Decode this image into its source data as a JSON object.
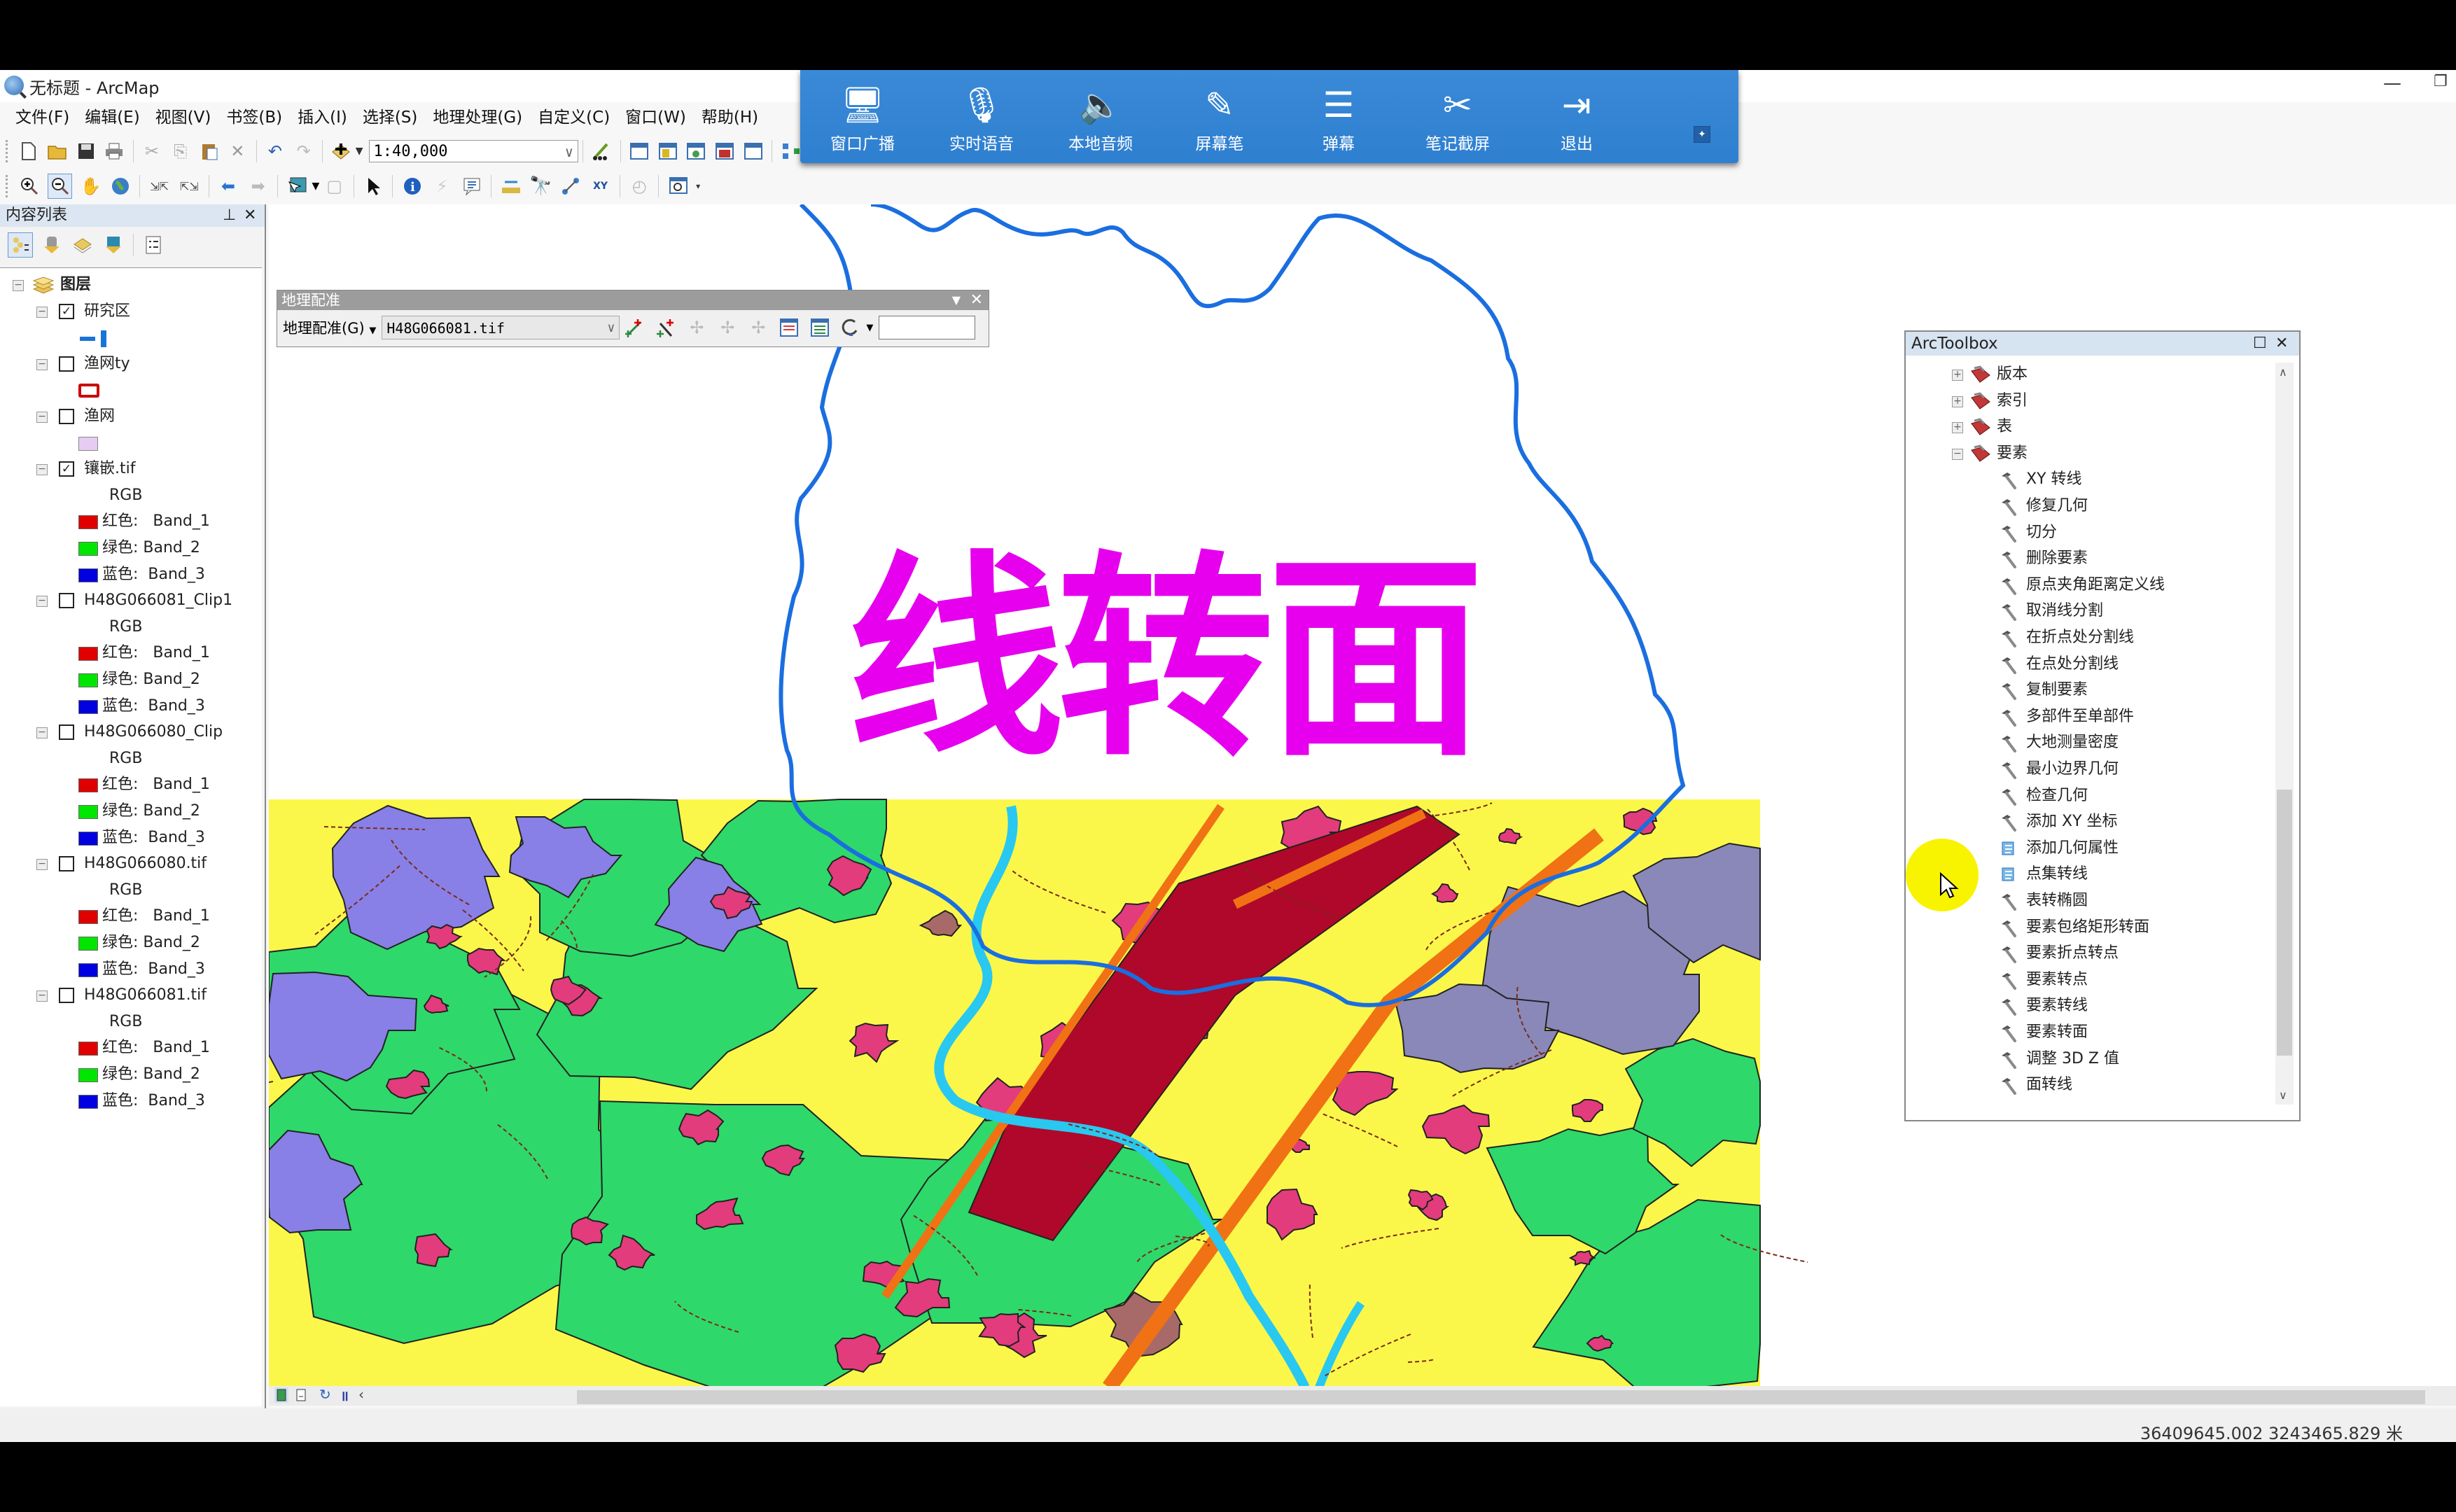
{
  "window": {
    "title": "无标题 - ArcMap",
    "minimize_icon": "minimize-icon",
    "restore_icon": "restore-icon"
  },
  "menu": [
    "文件(F)",
    "编辑(E)",
    "视图(V)",
    "书签(B)",
    "插入(I)",
    "选择(S)",
    "地理处理(G)",
    "自定义(C)",
    "窗口(W)",
    "帮助(H)"
  ],
  "standard_toolbar": {
    "icons": [
      "new-document-icon",
      "open-folder-icon",
      "save-icon",
      "print-icon",
      "cut-icon",
      "copy-icon",
      "paste-icon",
      "delete-icon",
      "undo-icon",
      "redo-icon",
      "add-data-icon"
    ],
    "scale": "1:40,000",
    "right_icons": [
      "editor-toolbar-icon",
      "toc-window-icon",
      "catalog-window-icon",
      "search-window-icon",
      "arctoolbox-icon",
      "python-window-icon",
      "modelbuilder-icon"
    ]
  },
  "tools_toolbar": {
    "icons": [
      "zoom-in-icon",
      "zoom-out-icon",
      "pan-icon",
      "full-extent-icon",
      "fixed-zoom-in-icon",
      "fixed-zoom-out-icon",
      "back-extent-icon",
      "forward-extent-icon",
      "select-features-icon",
      "clear-selection-icon",
      "select-elements-icon",
      "identify-icon",
      "hyperlink-icon",
      "html-popup-icon",
      "measure-icon",
      "find-icon",
      "find-route-icon",
      "go-to-xy-icon",
      "time-slider-icon",
      "magnifier-icon"
    ]
  },
  "overlay_toolbar": {
    "items": [
      {
        "label": "窗口广播",
        "icon": "screen-broadcast-icon"
      },
      {
        "label": "实时语音",
        "icon": "microphone-icon"
      },
      {
        "label": "本地音频",
        "icon": "local-audio-icon"
      },
      {
        "label": "屏幕笔",
        "icon": "screen-pen-icon"
      },
      {
        "label": "弹幕",
        "icon": "bullet-comment-icon"
      },
      {
        "label": "笔记截屏",
        "icon": "scissors-icon"
      },
      {
        "label": "退出",
        "icon": "exit-icon"
      }
    ],
    "accent": "#3386d6"
  },
  "toc": {
    "title": "内容列表",
    "root": "图层",
    "layers": [
      {
        "name": "研究区",
        "checked": true,
        "legend": {
          "type": "line",
          "color": "#1a73d8"
        }
      },
      {
        "name": "渔网ty",
        "checked": false,
        "legend": {
          "type": "outline",
          "color": "#cc0000"
        }
      },
      {
        "name": "渔网",
        "checked": false,
        "legend": {
          "type": "fill",
          "color": "#e6ccf2"
        }
      },
      {
        "name": "镶嵌.tif",
        "checked": true,
        "legend": {
          "type": "rgb"
        }
      },
      {
        "name": "H48G066081_Clip1",
        "checked": false,
        "legend": {
          "type": "rgb"
        }
      },
      {
        "name": "H48G066080_Clip",
        "checked": false,
        "legend": {
          "type": "rgb"
        }
      },
      {
        "name": "H48G066080.tif",
        "checked": false,
        "legend": {
          "type": "rgb"
        }
      },
      {
        "name": "H48G066081.tif",
        "checked": false,
        "legend": {
          "type": "rgb"
        }
      }
    ],
    "rgb_label": "RGB",
    "bands": [
      {
        "label": "红色:   Band_1",
        "color": "#e00000"
      },
      {
        "label": "绿色: Band_2",
        "color": "#00e600"
      },
      {
        "label": "蓝色:  Band_3",
        "color": "#0000e0"
      }
    ]
  },
  "georef_toolbar": {
    "title": "地理配准",
    "menu_label": "地理配准(G)",
    "layer": "H48G066081.tif",
    "icons": [
      "add-control-points-icon",
      "auto-adjust-icon",
      "select-link-icon",
      "zoom-to-selected-link-icon",
      "delete-link-icon",
      "view-link-table-icon",
      "view-link-table-2-icon",
      "rotate-icon"
    ]
  },
  "overlay_title": "线转面",
  "overlay_title_color": "#e600ee",
  "arctoolbox": {
    "title": "ArcToolbox",
    "toolsets": [
      {
        "label": "版本",
        "expanded": false
      },
      {
        "label": "索引",
        "expanded": false
      },
      {
        "label": "表",
        "expanded": false
      },
      {
        "label": "要素",
        "expanded": true
      }
    ],
    "tools": [
      {
        "label": "XY 转线",
        "icon": "hammer-icon"
      },
      {
        "label": "修复几何",
        "icon": "hammer-icon"
      },
      {
        "label": "切分",
        "icon": "hammer-icon"
      },
      {
        "label": "删除要素",
        "icon": "hammer-icon"
      },
      {
        "label": "原点夹角距离定义线",
        "icon": "hammer-icon"
      },
      {
        "label": "取消线分割",
        "icon": "hammer-icon"
      },
      {
        "label": "在折点处分割线",
        "icon": "hammer-icon"
      },
      {
        "label": "在点处分割线",
        "icon": "hammer-icon"
      },
      {
        "label": "复制要素",
        "icon": "hammer-icon"
      },
      {
        "label": "多部件至单部件",
        "icon": "hammer-icon"
      },
      {
        "label": "大地测量密度",
        "icon": "hammer-icon"
      },
      {
        "label": "最小边界几何",
        "icon": "hammer-icon"
      },
      {
        "label": "检查几何",
        "icon": "hammer-icon"
      },
      {
        "label": "添加 XY 坐标",
        "icon": "hammer-icon"
      },
      {
        "label": "添加几何属性",
        "icon": "script-icon"
      },
      {
        "label": "点集转线",
        "icon": "script-icon"
      },
      {
        "label": "表转椭圆",
        "icon": "hammer-icon"
      },
      {
        "label": "要素包络矩形转面",
        "icon": "hammer-icon"
      },
      {
        "label": "要素折点转点",
        "icon": "hammer-icon"
      },
      {
        "label": "要素转点",
        "icon": "hammer-icon"
      },
      {
        "label": "要素转线",
        "icon": "hammer-icon"
      },
      {
        "label": "要素转面",
        "icon": "hammer-icon"
      },
      {
        "label": "调整 3D Z 值",
        "icon": "hammer-icon"
      },
      {
        "label": "面转线",
        "icon": "hammer-icon"
      }
    ]
  },
  "map": {
    "colors": {
      "yellow": "#fbf74a",
      "green": "#2fd86a",
      "purple": "#8880e6",
      "slate": "#8a88b8",
      "pink": "#e23c7c",
      "crimson": "#b0082a",
      "orange": "#f07214",
      "cyan": "#28c8f0",
      "brown": "#a86a68",
      "boundary": "#1a6ee0"
    }
  },
  "bottom_bar": {
    "icons": [
      "data-view-icon",
      "layout-view-icon",
      "refresh-icon",
      "pause-drawing-icon",
      "scroll-left-icon"
    ]
  },
  "status": {
    "coordinates": "36409645.002  3243465.829 米"
  }
}
